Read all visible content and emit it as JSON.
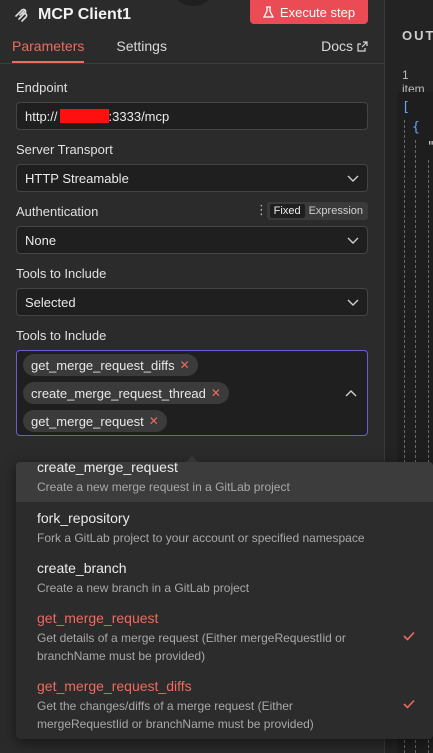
{
  "header": {
    "title": "MCP Client1",
    "execute_label": "Execute step"
  },
  "tabs": [
    {
      "label": "Parameters",
      "active": true
    },
    {
      "label": "Settings",
      "active": false
    }
  ],
  "docs_label": "Docs",
  "fields": {
    "endpoint": {
      "label": "Endpoint",
      "value_prefix": "http://",
      "value_suffix": ":3333/mcp"
    },
    "server_transport": {
      "label": "Server Transport",
      "value": "HTTP Streamable"
    },
    "authentication": {
      "label": "Authentication",
      "value": "None",
      "toggle": [
        "Fixed",
        "Expression"
      ]
    },
    "tools_mode": {
      "label": "Tools to Include",
      "value": "Selected"
    },
    "tools_selected": {
      "label": "Tools to Include",
      "tags": [
        "get_merge_request_diffs",
        "create_merge_request_thread",
        "get_merge_request"
      ]
    }
  },
  "dropdown": {
    "options": [
      {
        "name": "create_merge_request",
        "desc": "Create a new merge request in a GitLab project",
        "selected": false
      },
      {
        "name": "fork_repository",
        "desc": "Fork a GitLab project to your account or specified namespace",
        "selected": false
      },
      {
        "name": "create_branch",
        "desc": "Create a new branch in a GitLab project",
        "selected": false
      },
      {
        "name": "get_merge_request",
        "desc_line1": "Get details of a merge request (Either mergeRequestIid or",
        "desc_line2": "branchName must be provided)",
        "selected": true
      },
      {
        "name": "get_merge_request_diffs",
        "desc_line1": "Get the changes/diffs of a merge request (Either",
        "desc_line2": "mergeRequestIid or branchName must be provided)",
        "selected": true
      }
    ]
  },
  "output": {
    "title": "OUT",
    "count": "1 item",
    "json_lines": [
      "[",
      "{",
      "\""
    ]
  },
  "colors": {
    "accent": "#ef6a5f",
    "execute": "#ea4b54",
    "focus_border": "#6a5fd0"
  }
}
